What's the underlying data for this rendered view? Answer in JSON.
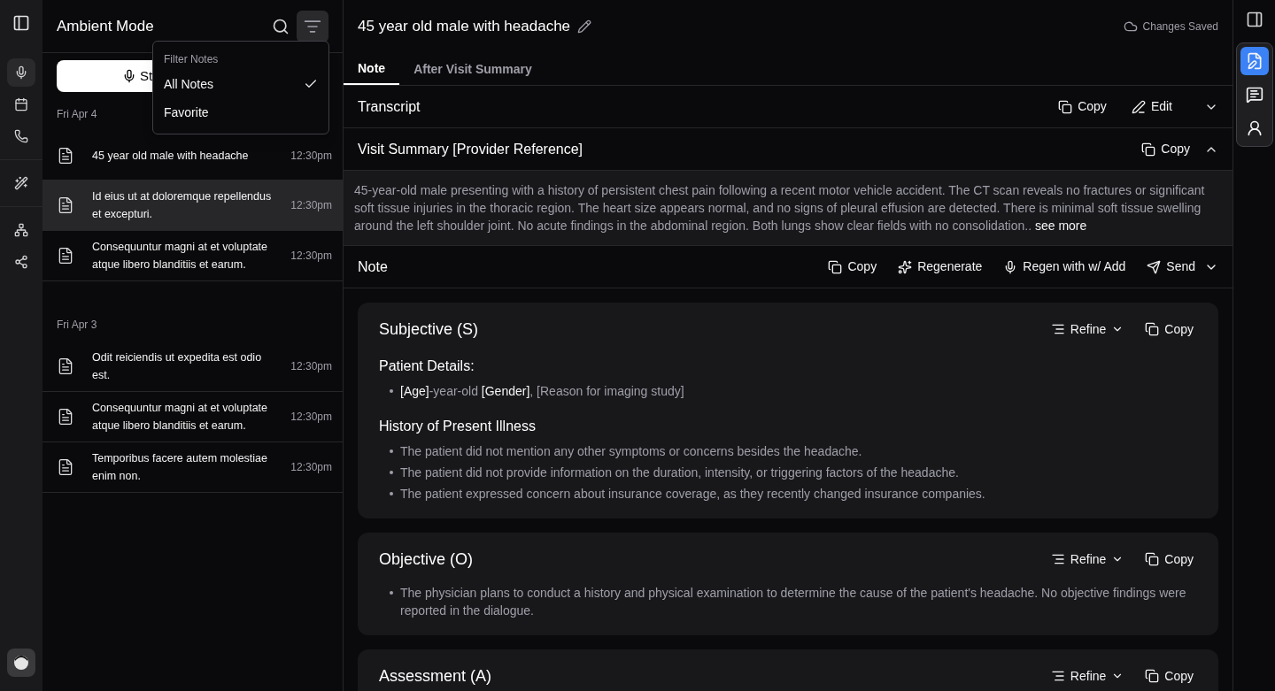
{
  "rail": {
    "items": [
      {
        "kind": "mic",
        "selected": true
      },
      {
        "kind": "calendar",
        "selected": false
      },
      {
        "kind": "phone",
        "selected": false
      },
      {
        "kind": "divider"
      },
      {
        "kind": "wand",
        "selected": false
      },
      {
        "kind": "divider"
      },
      {
        "kind": "network",
        "selected": false
      },
      {
        "kind": "share",
        "selected": false
      }
    ]
  },
  "list_panel": {
    "title": "Ambient Mode",
    "start_button": "St",
    "filter_active": true,
    "groups": [
      {
        "date": "Fri Apr 4",
        "notes": [
          {
            "title": "45 year old male with headache",
            "time": "12:30pm",
            "selected": false
          },
          {
            "title": "Id eius ut at doloremque repellendus et excepturi.",
            "time": "12:30pm",
            "selected": true
          },
          {
            "title": "Consequuntur magni at et voluptate atque libero blanditiis et earum.",
            "time": "12:30pm",
            "selected": false
          }
        ]
      },
      {
        "date": "Fri Apr 3",
        "notes": [
          {
            "title": "Odit reiciendis ut expedita est odio est.",
            "time": "12:30pm",
            "selected": false
          },
          {
            "title": "Consequuntur magni at et voluptate atque libero blanditiis et earum.",
            "time": "12:30pm",
            "selected": false
          },
          {
            "title": "Temporibus facere autem molestiae enim non.",
            "time": "12:30pm",
            "selected": false
          }
        ]
      }
    ],
    "filter_menu": {
      "heading": "Filter Notes",
      "options": [
        {
          "label": "All Notes",
          "selected": true
        },
        {
          "label": "Favorite",
          "selected": false
        }
      ]
    }
  },
  "main": {
    "title": "45 year old male with headache",
    "save_status": "Changes Saved",
    "tabs": [
      {
        "label": "Note",
        "selected": true
      },
      {
        "label": "After Visit Summary",
        "selected": false
      }
    ],
    "transcript": {
      "title": "Transcript",
      "copy": "Copy",
      "edit": "Edit",
      "expanded": false
    },
    "visit_summary": {
      "title": "Visit Summary [Provider Reference]",
      "copy": "Copy",
      "expanded": true,
      "text": "45-year-old male presenting with a history of persistent chest pain following a recent motor vehicle accident. The CT scan reveals no fractures or significant soft tissue injuries in the thoracic region. The heart size appears normal, and no signs of pleural effusion are detected. There is minimal soft tissue swelling around the left shoulder joint. No acute findings in the abdominal region. Both lungs show clear fields with no consolidation..",
      "see_more": "see more"
    },
    "note": {
      "title": "Note",
      "actions": [
        {
          "kind": "copy",
          "label": "Copy"
        },
        {
          "kind": "regenerate",
          "label": "Regenerate"
        },
        {
          "kind": "regen_add",
          "label": "Regen with w/ Add"
        },
        {
          "kind": "send",
          "label": "Send"
        }
      ]
    },
    "sections": [
      {
        "title": "Subjective (S)",
        "refine": "Refine",
        "copy": "Copy",
        "blocks": [
          {
            "heading": "Patient Details:",
            "items": [
              {
                "parts": [
                  {
                    "text": "[Age]",
                    "highlight": true
                  },
                  {
                    "text": "-year-old ",
                    "highlight": false
                  },
                  {
                    "text": "[Gender]",
                    "highlight": true
                  },
                  {
                    "text": ", [Reason for imaging study]",
                    "highlight": false
                  }
                ]
              }
            ]
          },
          {
            "heading": "History of Present Illness",
            "items": [
              {
                "parts": [
                  {
                    "text": "The patient did not mention any other symptoms or concerns besides the headache.",
                    "highlight": false
                  }
                ]
              },
              {
                "parts": [
                  {
                    "text": "The patient did not provide information on the duration, intensity, or triggering factors of the headache.",
                    "highlight": false
                  }
                ]
              },
              {
                "parts": [
                  {
                    "text": "The patient expressed concern about insurance coverage, as they recently changed insurance companies.",
                    "highlight": false
                  }
                ]
              }
            ]
          }
        ]
      },
      {
        "title": "Objective (O)",
        "refine": "Refine",
        "copy": "Copy",
        "blocks": [
          {
            "items": [
              {
                "parts": [
                  {
                    "text": "The physician plans to conduct a history and physical examination to determine the cause of the patient's headache. No objective findings were reported in the dialogue.",
                    "highlight": false
                  }
                ]
              }
            ]
          }
        ]
      },
      {
        "title": "Assessment (A)",
        "refine": "Refine",
        "copy": "Copy"
      }
    ]
  },
  "right_rail": {
    "items": [
      {
        "kind": "note",
        "selected": true
      },
      {
        "kind": "chat",
        "selected": false
      },
      {
        "kind": "assistant",
        "selected": false
      }
    ]
  }
}
